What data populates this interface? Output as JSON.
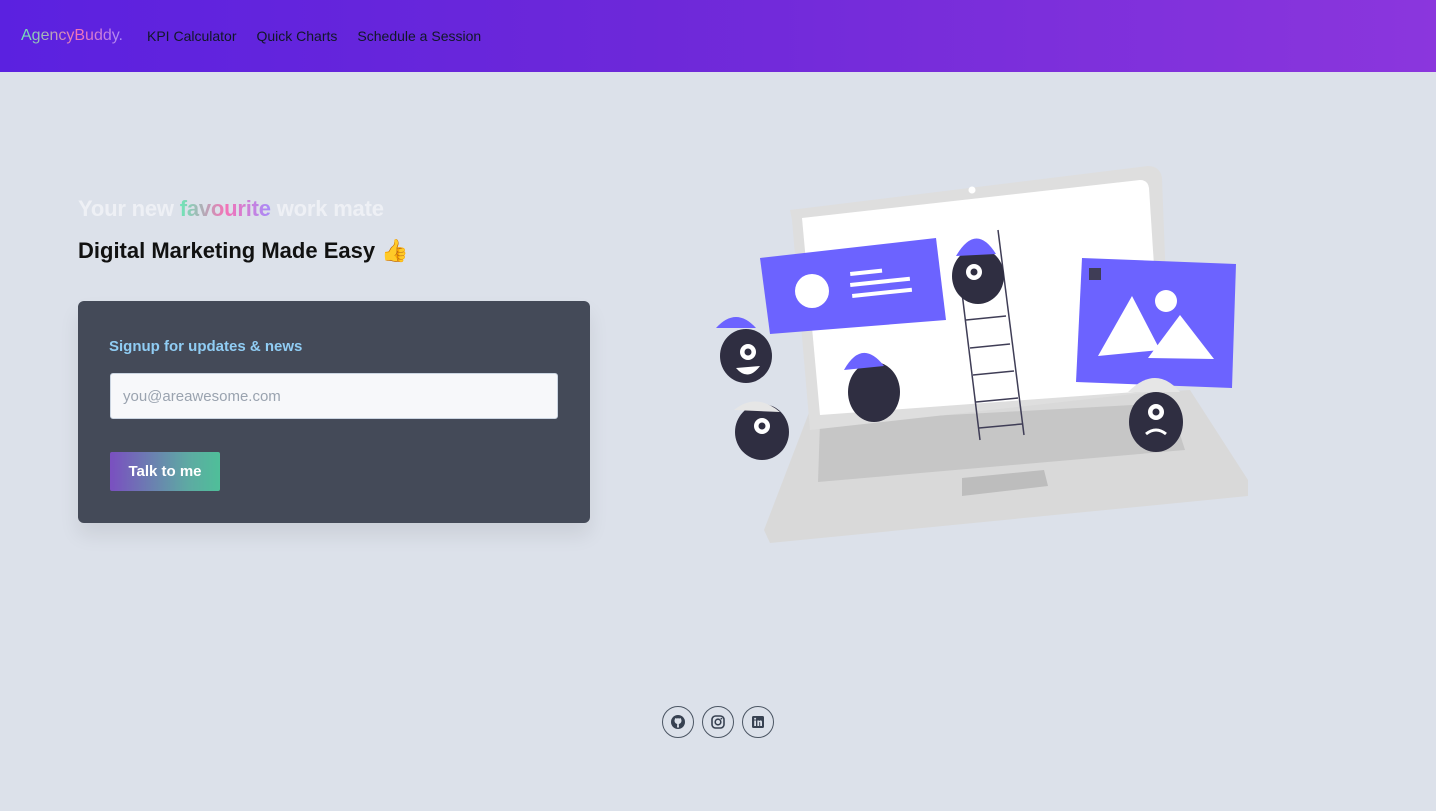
{
  "nav": {
    "brand": "AgencyBuddy.",
    "links": [
      "KPI Calculator",
      "Quick Charts",
      "Schedule a Session"
    ]
  },
  "hero": {
    "tagline_prefix": "Your new",
    "tagline_highlight": "favourite",
    "tagline_suffix": "work mate",
    "headline": "Digital Marketing Made Easy",
    "headline_emoji": "👍"
  },
  "signup": {
    "title": "Signup for updates & news",
    "email_placeholder": "you@areawesome.com",
    "email_value": "",
    "button_label": "Talk to me"
  },
  "social": {
    "icons": [
      "github-icon",
      "instagram-icon",
      "linkedin-icon"
    ]
  },
  "colors": {
    "navbar_start": "#5b21e0",
    "navbar_end": "#8b36dd",
    "page_bg": "#dce1ea",
    "card_bg": "#444a58",
    "card_title": "#90cdf4",
    "illustration_accent": "#6c63ff"
  }
}
